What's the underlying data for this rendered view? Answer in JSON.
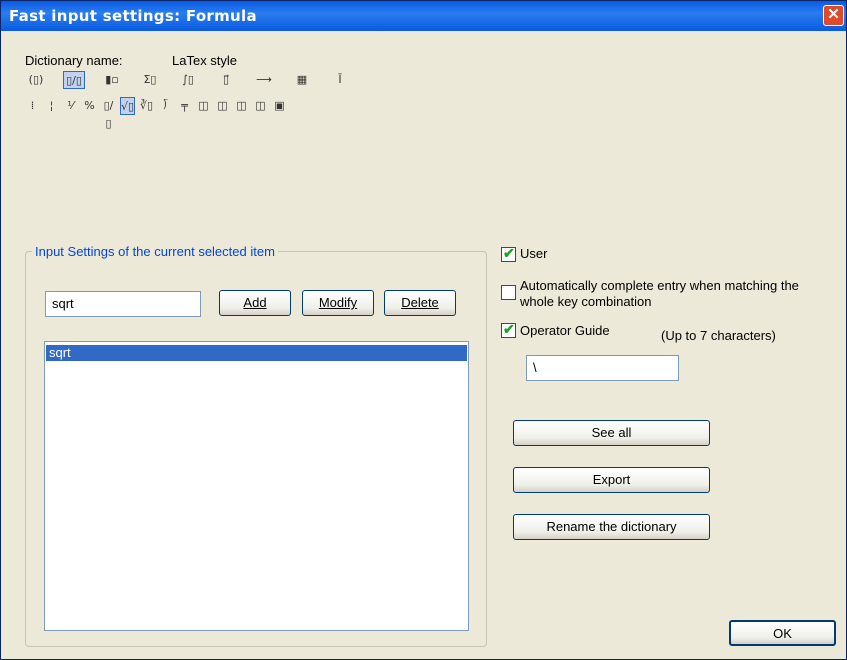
{
  "window": {
    "title": "Fast input settings: Formula"
  },
  "dictionary": {
    "label": "Dictionary name:",
    "value": "LaTex style"
  },
  "toolbar": {
    "row1": [
      {
        "icon": "parentheses-template-icon",
        "glyph": "(▯)"
      },
      {
        "icon": "fraction-template-icon",
        "glyph": "▯/▯",
        "selected": true
      },
      {
        "icon": "subscript-template-icon",
        "glyph": "▮▫"
      },
      {
        "icon": "summation-template-icon",
        "glyph": "Σ▯"
      },
      {
        "icon": "integral-template-icon",
        "glyph": "∫▯"
      },
      {
        "icon": "arrow-over-template-icon",
        "glyph": "▯⃗"
      },
      {
        "icon": "labeled-arrow-template-icon",
        "glyph": "⟶"
      },
      {
        "icon": "matrix-template-icon",
        "glyph": "▦"
      },
      {
        "icon": "accent-template-icon",
        "glyph": "Ī"
      }
    ],
    "row2": [
      {
        "icon": "stacked-fraction-icon",
        "glyph": "⁞"
      },
      {
        "icon": "small-fraction-icon",
        "glyph": "¦"
      },
      {
        "icon": "slash-fraction-icon",
        "glyph": "⅟"
      },
      {
        "icon": "diagonal-fraction-icon",
        "glyph": "%"
      },
      {
        "icon": "linear-fraction-icon",
        "glyph": "▯/▯"
      },
      {
        "icon": "square-root-icon",
        "glyph": "√▯",
        "selected": true
      },
      {
        "icon": "nth-root-icon",
        "glyph": "∛▯"
      },
      {
        "icon": "long-division-icon",
        "glyph": "⟌"
      },
      {
        "icon": "stacked-root-icon",
        "glyph": "╤"
      },
      {
        "icon": "box-left-icon",
        "glyph": "◫"
      },
      {
        "icon": "box-right-icon",
        "glyph": "◫"
      },
      {
        "icon": "box-bottom-left-icon",
        "glyph": "◫"
      },
      {
        "icon": "box-bottom-right-icon",
        "glyph": "◫"
      },
      {
        "icon": "box-full-icon",
        "glyph": "▣"
      }
    ]
  },
  "input_settings": {
    "legend": "Input Settings of the current selected item",
    "field_value": "sqrt",
    "add_label": "Add",
    "modify_label": "Modify",
    "delete_label": "Delete",
    "list_items": [
      "sqrt"
    ]
  },
  "options": {
    "user": {
      "label": "User",
      "checked": true
    },
    "autocomplete": {
      "label_line1": "Automatically complete entry when matching the",
      "label_line2": "whole key combination",
      "checked": false
    },
    "operator_guide": {
      "label": "Operator Guide",
      "checked": true,
      "hint": "(Up to 7 characters)",
      "value": "\\"
    }
  },
  "buttons": {
    "see_all": "See all",
    "export": "Export",
    "rename": "Rename the dictionary",
    "ok": "OK"
  }
}
